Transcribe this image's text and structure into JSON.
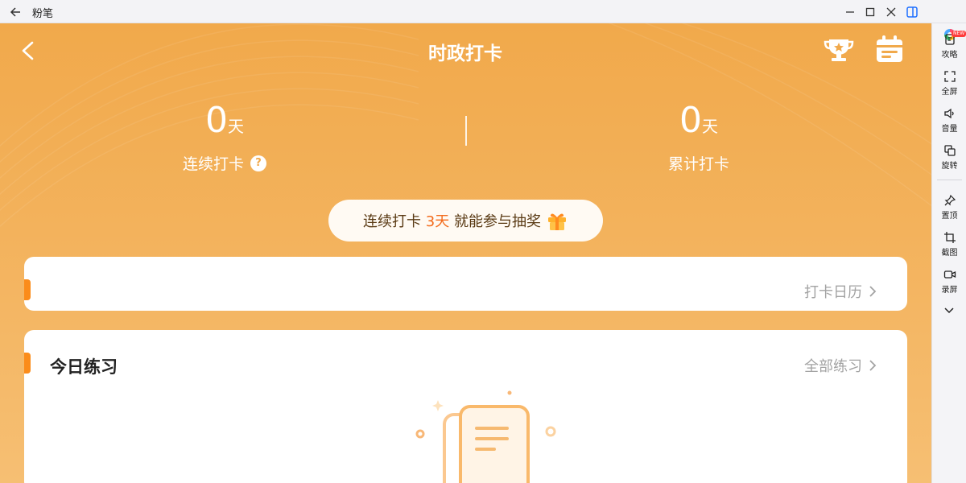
{
  "window": {
    "title": "粉笔"
  },
  "header": {
    "title": "时政打卡"
  },
  "stats": {
    "consecutive": {
      "value": "0",
      "unit": "天",
      "label": "连续打卡",
      "help": "?"
    },
    "total": {
      "value": "0",
      "unit": "天",
      "label": "累计打卡"
    }
  },
  "promo": {
    "prefix": "连续打卡 ",
    "highlight": "3天",
    "suffix": " 就能参与抽奖"
  },
  "calendar_card": {
    "link_label": "打卡日历"
  },
  "practice_card": {
    "title": "今日练习",
    "link_label": "全部练习"
  },
  "sidebar": {
    "items": [
      {
        "label": "攻略",
        "icon": "guide-icon",
        "badge": "NEW"
      },
      {
        "label": "全屏",
        "icon": "fullscreen-icon"
      },
      {
        "label": "音量",
        "icon": "volume-icon"
      },
      {
        "label": "旋转",
        "icon": "rotate-icon"
      },
      {
        "label": "置顶",
        "icon": "pin-icon"
      },
      {
        "label": "截图",
        "icon": "crop-icon"
      },
      {
        "label": "录屏",
        "icon": "record-icon"
      }
    ]
  },
  "colors": {
    "app_bg": "#f1a94b",
    "accent_orange": "#fb8c1a",
    "highlight_red": "#f36b1c"
  }
}
